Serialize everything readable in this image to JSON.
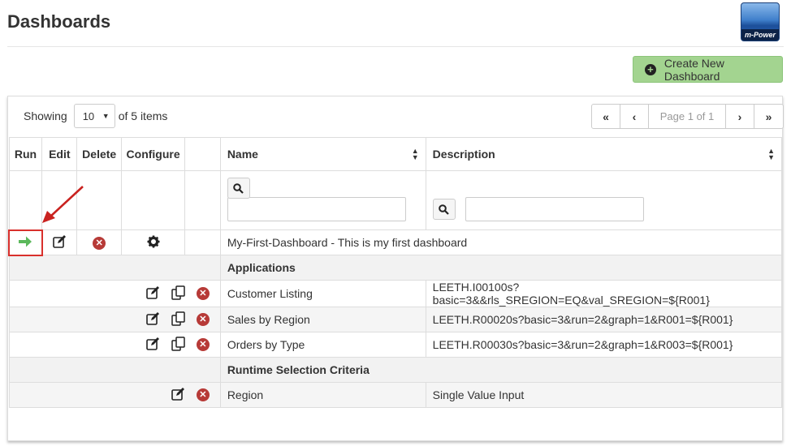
{
  "header": {
    "title": "Dashboards",
    "logo_text": "m-Power"
  },
  "actions": {
    "create_label": "Create New Dashboard"
  },
  "paging": {
    "showing_label": "Showing",
    "page_size": "10",
    "of_items": "of 5 items",
    "page_info": "Page 1 of 1",
    "first": "«",
    "prev": "‹",
    "next": "›",
    "last": "»"
  },
  "columns": {
    "run": "Run",
    "edit": "Edit",
    "delete": "Delete",
    "configure": "Configure",
    "name": "Name",
    "description": "Description"
  },
  "sort_glyph": "▲▼",
  "dashboard": {
    "name": "My-First-Dashboard - This is my first dashboard"
  },
  "sections": {
    "applications": "Applications",
    "runtime": "Runtime Selection Criteria"
  },
  "applications": [
    {
      "name": "Customer Listing",
      "description": "LEETH.I00100s?basic=3&&rls_SREGION=EQ&val_SREGION=${R001}"
    },
    {
      "name": "Sales by Region",
      "description": "LEETH.R00020s?basic=3&run=2&graph=1&R001=${R001}"
    },
    {
      "name": "Orders by Type",
      "description": "LEETH.R00030s?basic=3&run=2&graph=1&R003=${R001}"
    }
  ],
  "criteria": [
    {
      "name": "Region",
      "description": "Single Value Input"
    }
  ],
  "icons": {
    "run": "arrow-right-icon",
    "edit": "edit-icon",
    "delete": "delete-icon",
    "configure": "gear-icon",
    "copy": "copy-icon",
    "search": "search-icon",
    "plus": "plus-circle-icon"
  },
  "colors": {
    "accent_button": "#a3d490",
    "delete": "#b73a37",
    "run_arrow": "#5cb85c",
    "highlight_border": "#d9302c"
  }
}
